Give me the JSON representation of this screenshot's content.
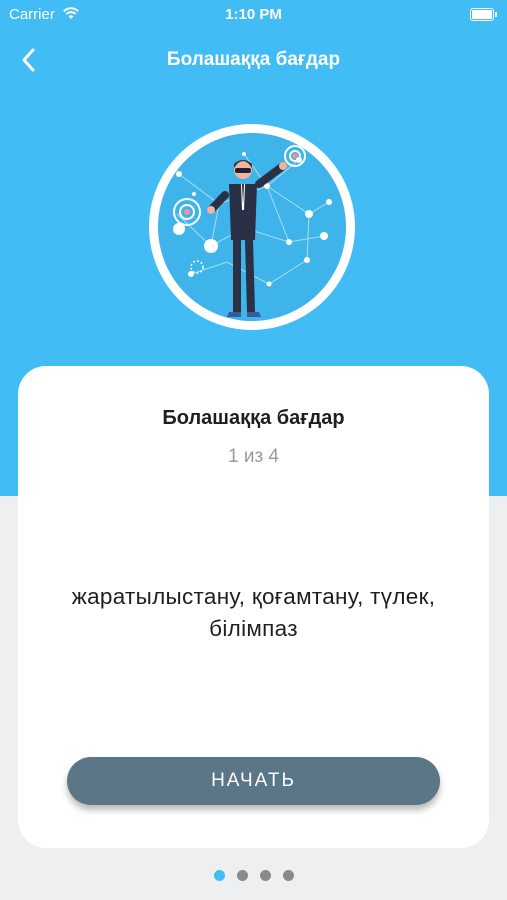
{
  "status_bar": {
    "carrier": "Carrier",
    "time": "1:10 PM"
  },
  "nav": {
    "title": "Болашаққа бағдар"
  },
  "card": {
    "title": "Болашаққа бағдар",
    "progress": "1 из 4",
    "keywords": "жаратылыстану, қоғамтану, түлек, білімпаз",
    "start_label": "НАЧАТЬ"
  },
  "pager": {
    "count": 4,
    "active_index": 0
  },
  "colors": {
    "accent": "#41bcf4",
    "button": "#5b7687",
    "background": "#eeeff1"
  }
}
